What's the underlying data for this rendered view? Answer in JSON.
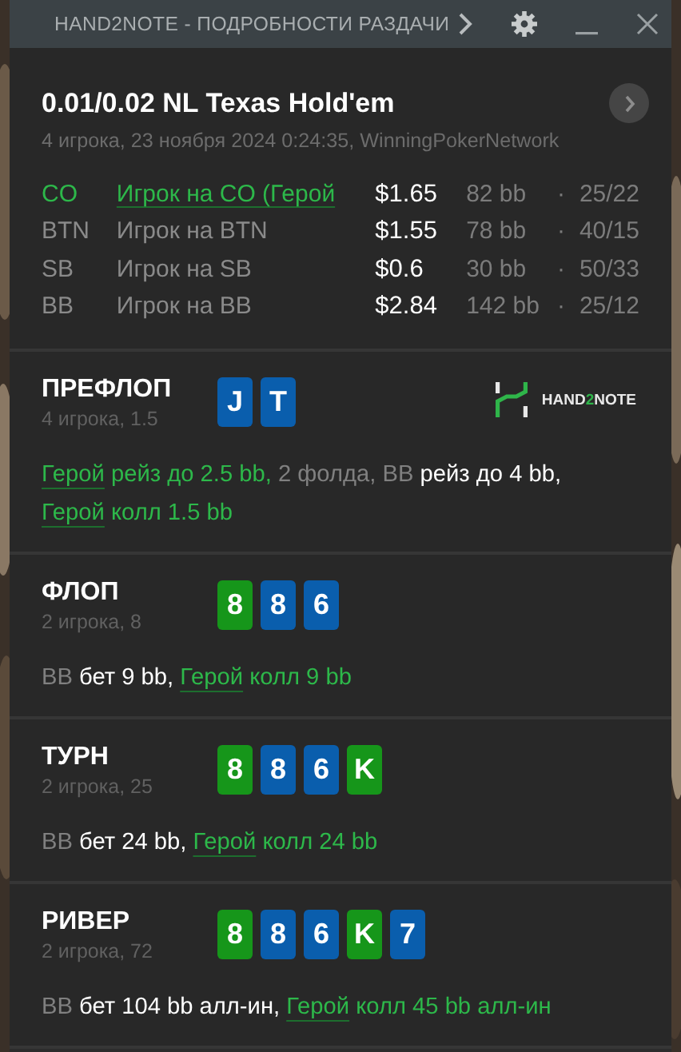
{
  "window": {
    "title": "HAND2NOTE - ПОДРОБНОСТИ РАЗДАЧИ"
  },
  "hand": {
    "title": "0.01/0.02 NL Texas Hold'em",
    "subtitle": "4 игрока, 23 ноября 2024 0:24:35, WinningPokerNetwork"
  },
  "players": [
    {
      "position": "CO",
      "name": "Игрок на CO (Герой",
      "stack": "$1.65",
      "bb": "82 bb",
      "dot": "·",
      "stats": "25/22",
      "hero": true
    },
    {
      "position": "BTN",
      "name": "Игрок на BTN",
      "stack": "$1.55",
      "bb": "78 bb",
      "dot": "·",
      "stats": "40/15",
      "hero": false
    },
    {
      "position": "SB",
      "name": "Игрок на SB",
      "stack": "$0.6",
      "bb": "30 bb",
      "dot": "·",
      "stats": "50/33",
      "hero": false
    },
    {
      "position": "BB",
      "name": "Игрок на BB",
      "stack": "$2.84",
      "bb": "142 bb",
      "dot": "·",
      "stats": "25/12",
      "hero": false
    }
  ],
  "logo": {
    "before": "HAND",
    "accent": "2",
    "after": "NOTE"
  },
  "streets": [
    {
      "name": "ПРЕФЛОП",
      "info": "4 игрока, 1.5",
      "logo": true,
      "cards": [
        {
          "rank": "J",
          "color": "#0a5ead"
        },
        {
          "rank": "T",
          "color": "#0a5ead"
        }
      ],
      "actions": [
        {
          "text": "Герой",
          "kind": "hero_link"
        },
        {
          "text": " рейз до 2.5 bb,",
          "kind": "hero"
        },
        {
          "text": " 2 фолда, BB",
          "kind": "player"
        },
        {
          "text": " рейз до 4 bb, ",
          "kind": "action"
        },
        {
          "text": "Герой",
          "kind": "hero_link"
        },
        {
          "text": " колл 1.5 bb",
          "kind": "hero"
        }
      ]
    },
    {
      "name": "ФЛОП",
      "info": "2 игрока, 8",
      "logo": false,
      "cards": [
        {
          "rank": "8",
          "color": "#16961a"
        },
        {
          "rank": "8",
          "color": "#0a5ead"
        },
        {
          "rank": "6",
          "color": "#0a5ead"
        }
      ],
      "actions": [
        {
          "text": "BB",
          "kind": "player"
        },
        {
          "text": " бет 9 bb, ",
          "kind": "action"
        },
        {
          "text": "Герой",
          "kind": "hero_link"
        },
        {
          "text": " колл 9 bb",
          "kind": "hero"
        }
      ]
    },
    {
      "name": "ТУРН",
      "info": "2 игрока, 25",
      "logo": false,
      "cards": [
        {
          "rank": "8",
          "color": "#16961a"
        },
        {
          "rank": "8",
          "color": "#0a5ead"
        },
        {
          "rank": "6",
          "color": "#0a5ead"
        },
        {
          "rank": "K",
          "color": "#16961a"
        }
      ],
      "actions": [
        {
          "text": "BB",
          "kind": "player"
        },
        {
          "text": " бет 24 bb, ",
          "kind": "action"
        },
        {
          "text": "Герой",
          "kind": "hero_link"
        },
        {
          "text": " колл 24 bb",
          "kind": "hero"
        }
      ]
    },
    {
      "name": "РИВЕР",
      "info": "2 игрока, 72",
      "logo": false,
      "cards": [
        {
          "rank": "8",
          "color": "#16961a"
        },
        {
          "rank": "8",
          "color": "#0a5ead"
        },
        {
          "rank": "6",
          "color": "#0a5ead"
        },
        {
          "rank": "K",
          "color": "#16961a"
        },
        {
          "rank": "7",
          "color": "#0a5ead"
        }
      ],
      "actions": [
        {
          "text": "BB",
          "kind": "player"
        },
        {
          "text": " бет 104 bb алл-ин, ",
          "kind": "action"
        },
        {
          "text": "Герой",
          "kind": "hero_link"
        },
        {
          "text": " колл 45 bb алл-ин",
          "kind": "hero"
        }
      ]
    }
  ]
}
